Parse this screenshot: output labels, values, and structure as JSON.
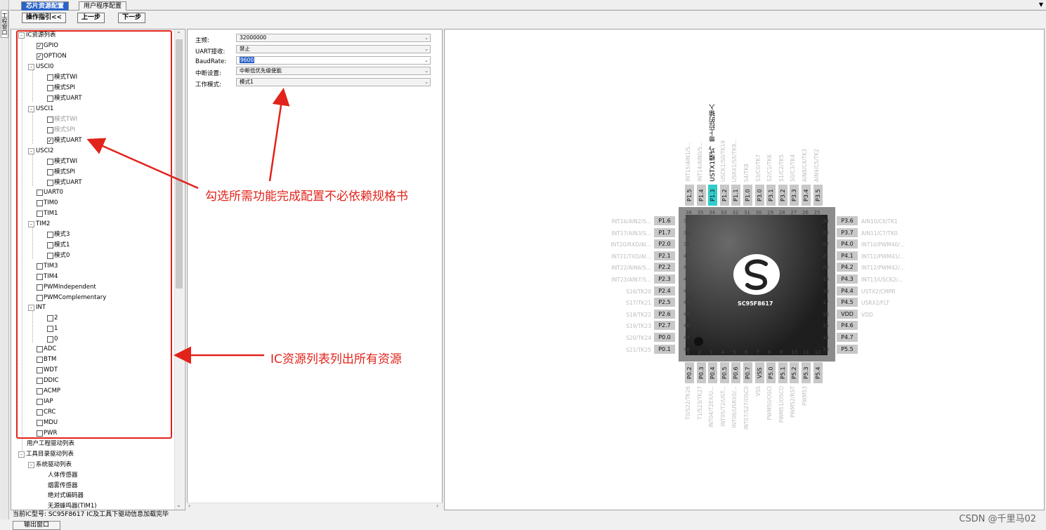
{
  "tabs": {
    "chip_config": "芯片资源配置",
    "user_config": "用户程序配置",
    "menu": "▼"
  },
  "side_tab": "工程窗口",
  "toolbar": {
    "guide": "操作指引<<",
    "prev": "上一步",
    "next": "下一步"
  },
  "tree": {
    "root": "IC资源列表",
    "gpio": "GPIO",
    "option": "OPTION",
    "usci0": "USCI0",
    "usci0_twi": "模式TWI",
    "usci0_spi": "模式SPI",
    "usci0_uart": "模式UART",
    "usci1": "USCI1",
    "usci1_twi": "模式TWI",
    "usci1_spi": "模式SPI",
    "usci1_uart": "模式UART",
    "usci2": "USCI2",
    "usci2_twi": "模式TWI",
    "usci2_spi": "模式SPI",
    "usci2_uart": "模式UART",
    "uart0": "UART0",
    "tim0": "TIM0",
    "tim1": "TIM1",
    "tim2": "TIM2",
    "tim2_m3": "模式3",
    "tim2_m1": "模式1",
    "tim2_m0": "模式0",
    "tim3": "TIM3",
    "tim4": "TIM4",
    "pwm_ind": "PWMIndependent",
    "pwm_comp": "PWMComplementary",
    "int": "INT",
    "int2": "2",
    "int1": "1",
    "int0": "0",
    "adc": "ADC",
    "btm": "BTM",
    "wdt": "WDT",
    "ddic": "DDIC",
    "acmp": "ACMP",
    "iap": "IAP",
    "crc": "CRC",
    "mdu": "MDU",
    "pwr": "PWR",
    "user_drv": "用户工程驱动列表",
    "tool_drv": "工具目录驱动列表",
    "sys_drv": "系统驱动列表",
    "d1": "人体传感器",
    "d2": "烟雾传感器",
    "d3": "绝对式编码器",
    "d4": "无源蜂鸣器(TIM1)"
  },
  "config": {
    "freq_label": "主频:",
    "freq_value": "32000000",
    "uart_label": "UART接收:",
    "uart_value": "禁止",
    "baud_label": "BaudRate:",
    "baud_value": "9600",
    "irq_label": "中断设置:",
    "irq_value": "中断低优先级使能",
    "mode_label": "工作模式:",
    "mode_value": "模式1"
  },
  "chip": {
    "name": "SC95F8617",
    "top_pins": [
      "P1.5",
      "P1.4",
      "P1.3",
      "P1.2",
      "P1.1",
      "P1.0",
      "P3.0",
      "P3.1",
      "P3.2",
      "P3.3",
      "P3.4",
      "P3.5"
    ],
    "top_nums": [
      "36",
      "35",
      "34",
      "33",
      "32",
      "31",
      "30",
      "29",
      "28",
      "27",
      "26",
      "25"
    ],
    "top_funcs": [
      "INT15/AIN1/S...",
      "INT14/AIN0/S...",
      "USTX1模式，带上拉的输入",
      "USCK1/S0/TK19",
      "USRX1/S5/TK9...",
      "S4/TK8",
      "S3/C0/TK7",
      "S2/C1/TK6",
      "S1/C2/TK5",
      "S0/C3/TK4",
      "AIN8/C4/TK3",
      "AIN9/C5/TK2"
    ],
    "left_pins": [
      "P1.6",
      "P1.7",
      "P2.0",
      "P2.1",
      "P2.2",
      "P2.3",
      "P2.4",
      "P2.5",
      "P2.6",
      "P2.7",
      "P0.0",
      "P0.1"
    ],
    "left_nums": [
      "37",
      "38",
      "39",
      "40",
      "41",
      "42",
      "43",
      "44",
      "45",
      "46",
      "47",
      "48"
    ],
    "left_funcs": [
      "INT16/AIN2/S...",
      "INT17/AIN3/S...",
      "INT20/RXD/AI...",
      "INT21/TXD/AI...",
      "INT22/AIN6/S...",
      "INT23/AIN7/S...",
      "S16/TK20",
      "S17/TK21",
      "S18/TK22",
      "S19/TK23",
      "S20/TK24",
      "S21/TK25"
    ],
    "right_pins": [
      "P3.6",
      "P3.7",
      "P4.0",
      "P4.1",
      "P4.2",
      "P4.3",
      "P4.4",
      "P4.5",
      "VDD",
      "P4.6",
      "P4.7",
      "P5.5"
    ],
    "right_nums": [
      "24",
      "23",
      "22",
      "21",
      "20",
      "19",
      "18",
      "17",
      "16",
      "15",
      "14",
      "13"
    ],
    "right_funcs": [
      "AIN10/C6/TK1",
      "AIN11/C7/TK0",
      "INT10/PWM40/...",
      "INT11/PWM41/...",
      "INT12/PWM42/...",
      "INT13/USCK2/...",
      "USTX2/CMPR",
      "USRX2/FLT",
      "VDD",
      "",
      "",
      ""
    ],
    "bottom_pins": [
      "P0.2",
      "P0.3",
      "P0.4",
      "P0.5",
      "P0.6",
      "P0.7",
      "VSS",
      "P5.0",
      "P5.1",
      "P5.2",
      "P5.3",
      "P5.4"
    ],
    "bottom_nums": [
      "1",
      "2",
      "3",
      "4",
      "5",
      "6",
      "7",
      "8",
      "9",
      "10",
      "11",
      "12"
    ],
    "bottom_funcs": [
      "T0/S22/TK26",
      "T1/S23/TK27",
      "INT04/T2EX/U...",
      "INT05/T2/UST...",
      "INT06/USRX0/...",
      "INT07/S27/OSC0",
      "VSS",
      "PWM50/OSCI",
      "PWM51/OSCO",
      "PWM52/RST",
      "PWM53",
      ""
    ]
  },
  "status": {
    "text": "当前IC型号:   SC95F8617  IC及工具下驱动信息加载完毕",
    "output_tab": "输出窗口",
    "watermark": "CSDN @千里马02"
  },
  "annotations": {
    "right": "勾选所需功能完成配置不必依赖规格书",
    "bottom": "IC资源列表列出所有资源"
  },
  "colors": {
    "accent": "#2a62c8",
    "annotation_red": "#e2231a",
    "selected_pin": "#33cccc"
  }
}
